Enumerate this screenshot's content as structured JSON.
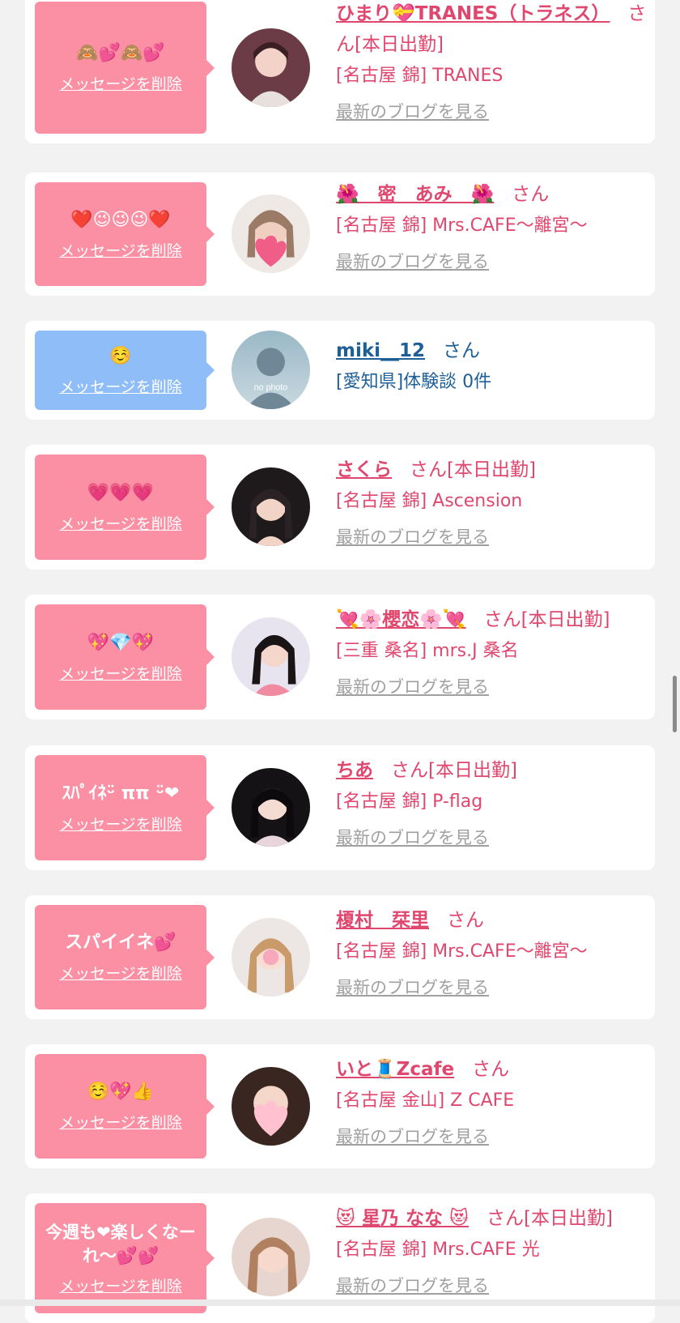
{
  "delete_label": "メッセージを削除",
  "blog_label": "最新のブログを見る",
  "san_label": "さん",
  "colors": {
    "pink": "#fb8fa3",
    "blue": "#8fbdf7",
    "name_pink": "#e0476e",
    "name_blue": "#1e5f98"
  },
  "items": [
    {
      "message": "🙈💕🙈💕",
      "bubble_color": "pink",
      "name": "ひまり💝TRANES（トラネス）",
      "suffix": "[本日出勤]",
      "shop": "[名古屋 錦] TRANES",
      "blog": true,
      "avatar_icon": "profile-photo-icon"
    },
    {
      "message": "❤️😉😉😉❤️",
      "bubble_color": "pink",
      "name": "🌺　密　あみ　🌺",
      "suffix": "",
      "shop": "[名古屋 錦] Mrs.CAFE～離宮～",
      "blog": true,
      "avatar_icon": "profile-photo-icon"
    },
    {
      "message": "☺️",
      "bubble_color": "blue",
      "name": "miki__12",
      "suffix": "",
      "shop": "[愛知県]体験談 0件",
      "blog": false,
      "avatar_icon": "no-photo-icon",
      "avatar_text": "no photo"
    },
    {
      "message": "💗💗💗",
      "bubble_color": "pink",
      "name": "さくら",
      "suffix": "[本日出勤]",
      "shop": "[名古屋 錦] Ascension",
      "blog": true,
      "avatar_icon": "profile-photo-icon"
    },
    {
      "message": "💖💎💖",
      "bubble_color": "pink",
      "name": "💘🌸櫻恋🌸💘",
      "suffix": "[本日出勤]",
      "shop": "[三重 桑名] mrs.J 桑名",
      "blog": true,
      "avatar_icon": "profile-photo-icon"
    },
    {
      "message": "ｽﾊﾟｲﾈᵕ̈ ππ ᵕ̈❤",
      "bubble_color": "pink",
      "name": "ちあ",
      "suffix": "[本日出勤]",
      "shop": "[名古屋 錦] P-flag",
      "blog": true,
      "avatar_icon": "profile-photo-icon"
    },
    {
      "message": "スパイイネ💕",
      "bubble_color": "pink",
      "name": "榎村　栞里",
      "suffix": "",
      "shop": "[名古屋 錦] Mrs.CAFE～離宮～",
      "blog": true,
      "avatar_icon": "profile-photo-icon"
    },
    {
      "message": "☺️💖👍",
      "bubble_color": "pink",
      "name": "いと🧵Zcafe",
      "suffix": "",
      "shop": "[名古屋 金山] Z CAFE",
      "blog": true,
      "avatar_icon": "profile-photo-icon"
    },
    {
      "message": "今週も❤楽しくなーれ〜💕💕",
      "bubble_color": "pink",
      "name": "😻 星乃 なな 😻",
      "suffix": "[本日出勤]",
      "shop": "[名古屋 錦] Mrs.CAFE 光",
      "blog": true,
      "avatar_icon": "profile-photo-icon"
    }
  ]
}
